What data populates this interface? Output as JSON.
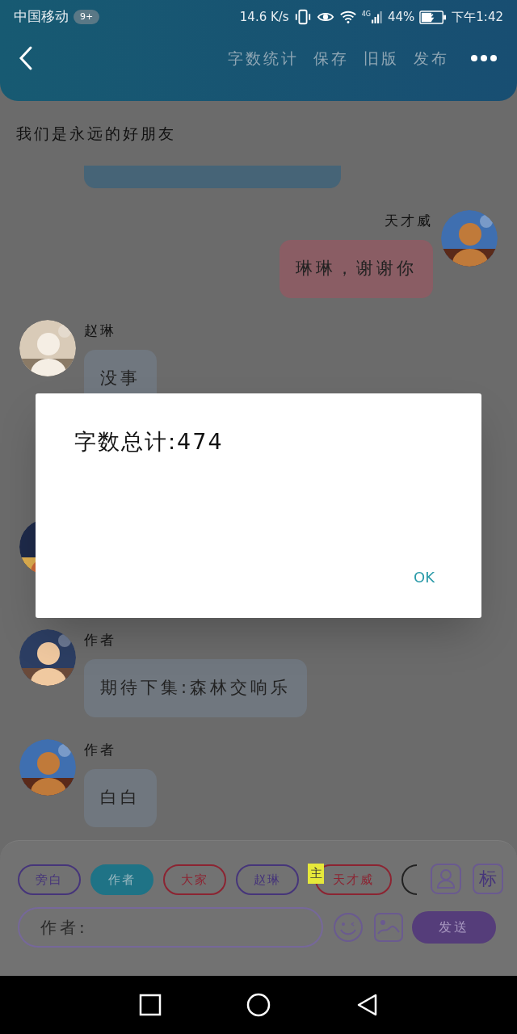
{
  "status_bar": {
    "carrier": "中国移动",
    "badge": "9+",
    "speed": "14.6 K/s",
    "network": "4G",
    "battery": "44%",
    "time": "下午1:42"
  },
  "toolbar": {
    "actions": [
      "字数统计",
      "保存",
      "旧版",
      "发布"
    ]
  },
  "title": "我们是永远的好朋友",
  "messages": [
    {
      "kind": "cut",
      "color": "#466477"
    },
    {
      "kind": "sent",
      "sender": "天才威",
      "text": "琳琳，谢谢你",
      "color": "#8a5d64"
    },
    {
      "kind": "received",
      "sender": "赵琳",
      "text": "没事",
      "color": "#70777f"
    },
    {
      "kind": "hidden"
    },
    {
      "kind": "received",
      "sender": "作者",
      "text": "期待下集:森林交响乐",
      "color": "#70777f"
    },
    {
      "kind": "received",
      "sender": "作者",
      "text": "白白",
      "color": "#70777f"
    }
  ],
  "roles": [
    {
      "label": "旁白",
      "color": "#46357a",
      "selected": false
    },
    {
      "label": "作者",
      "color": "#1f7386",
      "selected": true
    },
    {
      "label": "大家",
      "color": "#8c2432",
      "selected": false
    },
    {
      "label": "赵琳",
      "color": "#46357a",
      "selected": false
    },
    {
      "label": "天才威",
      "color": "#8c2432",
      "selected": false,
      "badge": "主"
    },
    {
      "color": "#222222",
      "selected": false
    }
  ],
  "mark_button": "标",
  "input": {
    "placeholder": "作者:"
  },
  "send_button": "发送",
  "dialog": {
    "message": "字数总计:474",
    "button": "OK"
  }
}
